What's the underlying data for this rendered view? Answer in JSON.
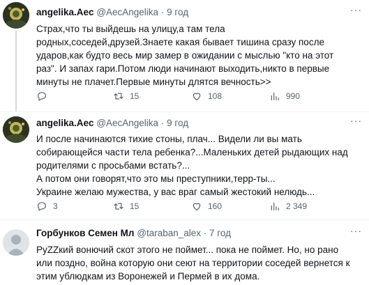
{
  "tweets": [
    {
      "name": "angelika.Aec",
      "handle": "@AecAngelika",
      "time": "· 9 год",
      "lines": [
        "Страх,что ты выйдешь на улицу,а там тела",
        "родных,соседей,друзей.Знаете какая бывает тишина сразу после",
        "ударов,как будто весь мир замер в ожидании с мыслью \"кто на этот",
        "раз\". И запах гари.Потом люди начинают выходить,никто в первые",
        "минуты не плачет.Первые минуты длятся вечность>>"
      ],
      "actions": {
        "reply": "",
        "retweet": "15",
        "like": "108",
        "views": "990"
      }
    },
    {
      "name": "angelika.Aec",
      "handle": "@AecAngelika",
      "time": "· 9 год",
      "lines": [
        "И после начинаются тихие стоны, плач... Видели ли вы мать",
        "собирающейся части тела ребенка?...Маленьких детей рыдающих над",
        "родителями с просьбами встать?...",
        "А потом они говорят,что это мы преступники,терр-ты...",
        "Украине желаю мужества, у вас враг самый жестокий нелюдь..."
      ],
      "actions": {
        "reply": "3",
        "retweet": "15",
        "like": "160",
        "views": "2 349"
      }
    },
    {
      "name": "Горбунков Семен Мл",
      "handle": "@taraban_alex",
      "time": "· 7 год",
      "lines": [
        "PyZZкий вонючий скот этого не поймет... пока не поймет. Но, но рано",
        "или поздно, война которую они сеют на территории соседей вернется к",
        "этим ублюдкам из Воронежей и Пермей в их дома."
      ]
    }
  ],
  "icons": {
    "more": "more-dots-icon",
    "reply": "reply-icon",
    "retweet": "retweet-icon",
    "like": "like-icon",
    "views": "views-icon"
  },
  "colors": {
    "text": "#0f1419",
    "secondary": "#536471",
    "divider": "#eff3f4"
  }
}
